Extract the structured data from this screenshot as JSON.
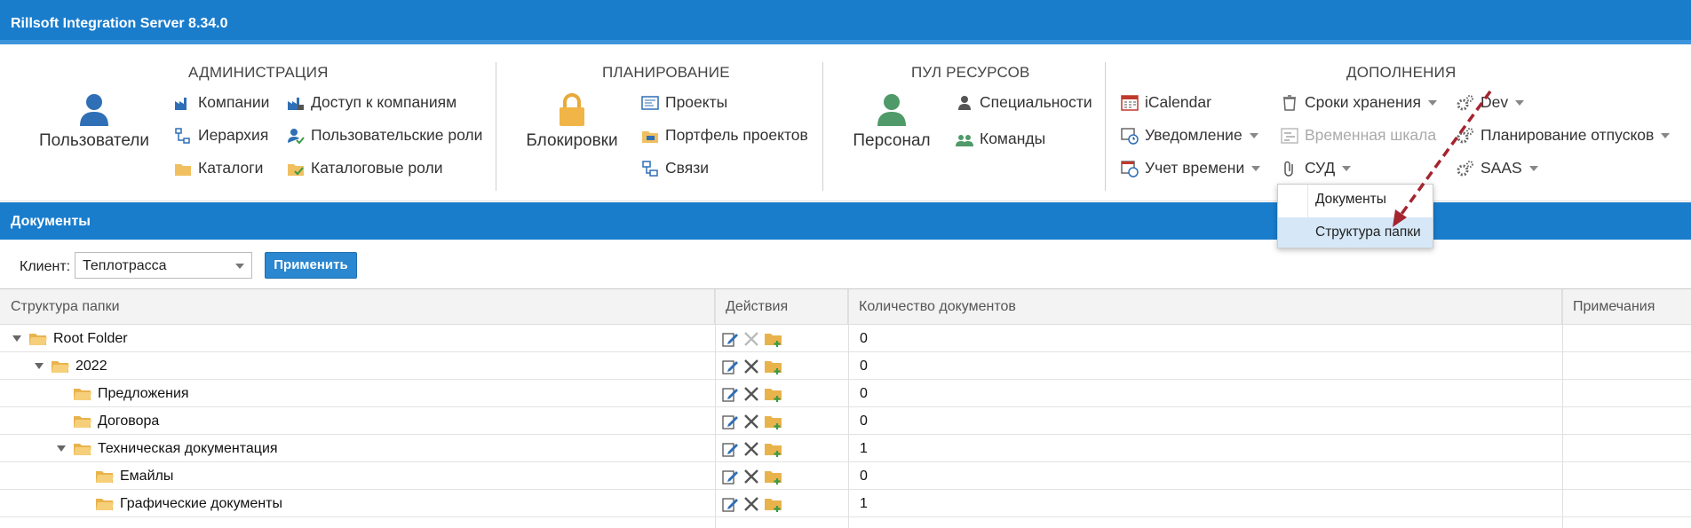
{
  "app": {
    "title": "Rillsoft Integration Server 8.34.0"
  },
  "ribbon": {
    "admin": {
      "title": "АДМИНИСТРАЦИЯ",
      "big_label": "Пользователи",
      "items": [
        "Компании",
        "Доступ к компаниям",
        "Иерархия",
        "Пользовательские роли",
        "Каталоги",
        "Каталоговые роли"
      ]
    },
    "planning": {
      "title": "ПЛАНИРОВАНИЕ",
      "big_label": "Блокировки",
      "items": [
        "Проекты",
        "Портфель проектов",
        "Связи"
      ]
    },
    "pool": {
      "title": "ПУЛ РЕСУРСОВ",
      "big_label": "Персонал",
      "items": [
        "Специальности",
        "Команды"
      ]
    },
    "addons": {
      "title": "ДОПОЛНЕНИЯ",
      "items": [
        "iCalendar",
        "Сроки хранения",
        "Dev",
        "Уведомление",
        "Временная шкала",
        "Планирование отпусков",
        "Учет времени",
        "СУД",
        "SAAS"
      ]
    }
  },
  "dropdown": {
    "items": [
      "Документы",
      "Структура папки"
    ],
    "selected": "Структура папки"
  },
  "section": {
    "title": "Документы"
  },
  "filter": {
    "label": "Клиент:",
    "value": "Теплотрасса",
    "apply": "Применить"
  },
  "grid": {
    "columns": [
      "Структура папки",
      "Действия",
      "Количество документов",
      "Примечания"
    ],
    "rows": [
      {
        "name": "Root Folder",
        "count": "0",
        "level": 0,
        "expanded": true
      },
      {
        "name": "2022",
        "count": "0",
        "level": 1,
        "expanded": true
      },
      {
        "name": "Предложения",
        "count": "0",
        "level": 2,
        "expanded": false
      },
      {
        "name": "Договора",
        "count": "0",
        "level": 2,
        "expanded": false
      },
      {
        "name": "Техническая документация",
        "count": "1",
        "level": 2,
        "expanded": true
      },
      {
        "name": "Емайлы",
        "count": "0",
        "level": 3,
        "expanded": false
      },
      {
        "name": "Графические документы",
        "count": "1",
        "level": 3,
        "expanded": false
      }
    ]
  },
  "colors": {
    "brand": "#1a7dcc",
    "folder": "#f0c060",
    "annotation_arrow": "#a4242f"
  }
}
